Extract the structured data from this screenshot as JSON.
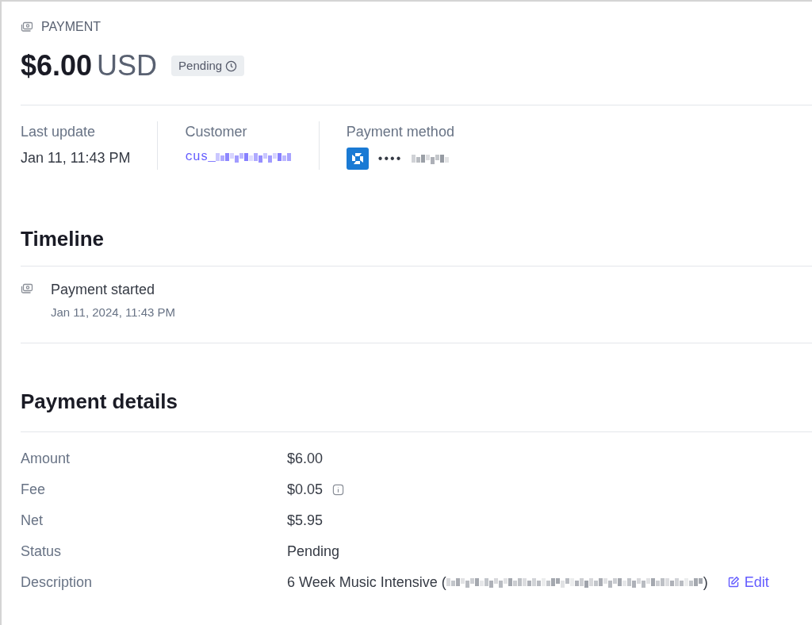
{
  "header": {
    "kicker": "PAYMENT",
    "amount": "$6.00",
    "currency": "USD",
    "status_badge": "Pending"
  },
  "summary": [
    {
      "label": "Last update",
      "kind": "text",
      "value": "Jan 11, 11:43 PM"
    },
    {
      "label": "Customer",
      "kind": "link",
      "value": "cus_"
    },
    {
      "label": "Payment method",
      "kind": "card",
      "value": "••••"
    }
  ],
  "timeline": {
    "title": "Timeline",
    "events": [
      {
        "title": "Payment started",
        "time": "Jan 11, 2024, 11:43 PM"
      }
    ]
  },
  "details": {
    "title": "Payment details",
    "rows": [
      {
        "label": "Amount",
        "value": "$6.00"
      },
      {
        "label": "Fee",
        "value": "$0.05",
        "info": true
      },
      {
        "label": "Net",
        "value": "$5.95"
      },
      {
        "label": "Status",
        "value": "Pending"
      },
      {
        "label": "Description",
        "value": "6 Week Music Intensive (",
        "value_end": ")",
        "redacted": true,
        "action": "Edit"
      }
    ]
  }
}
